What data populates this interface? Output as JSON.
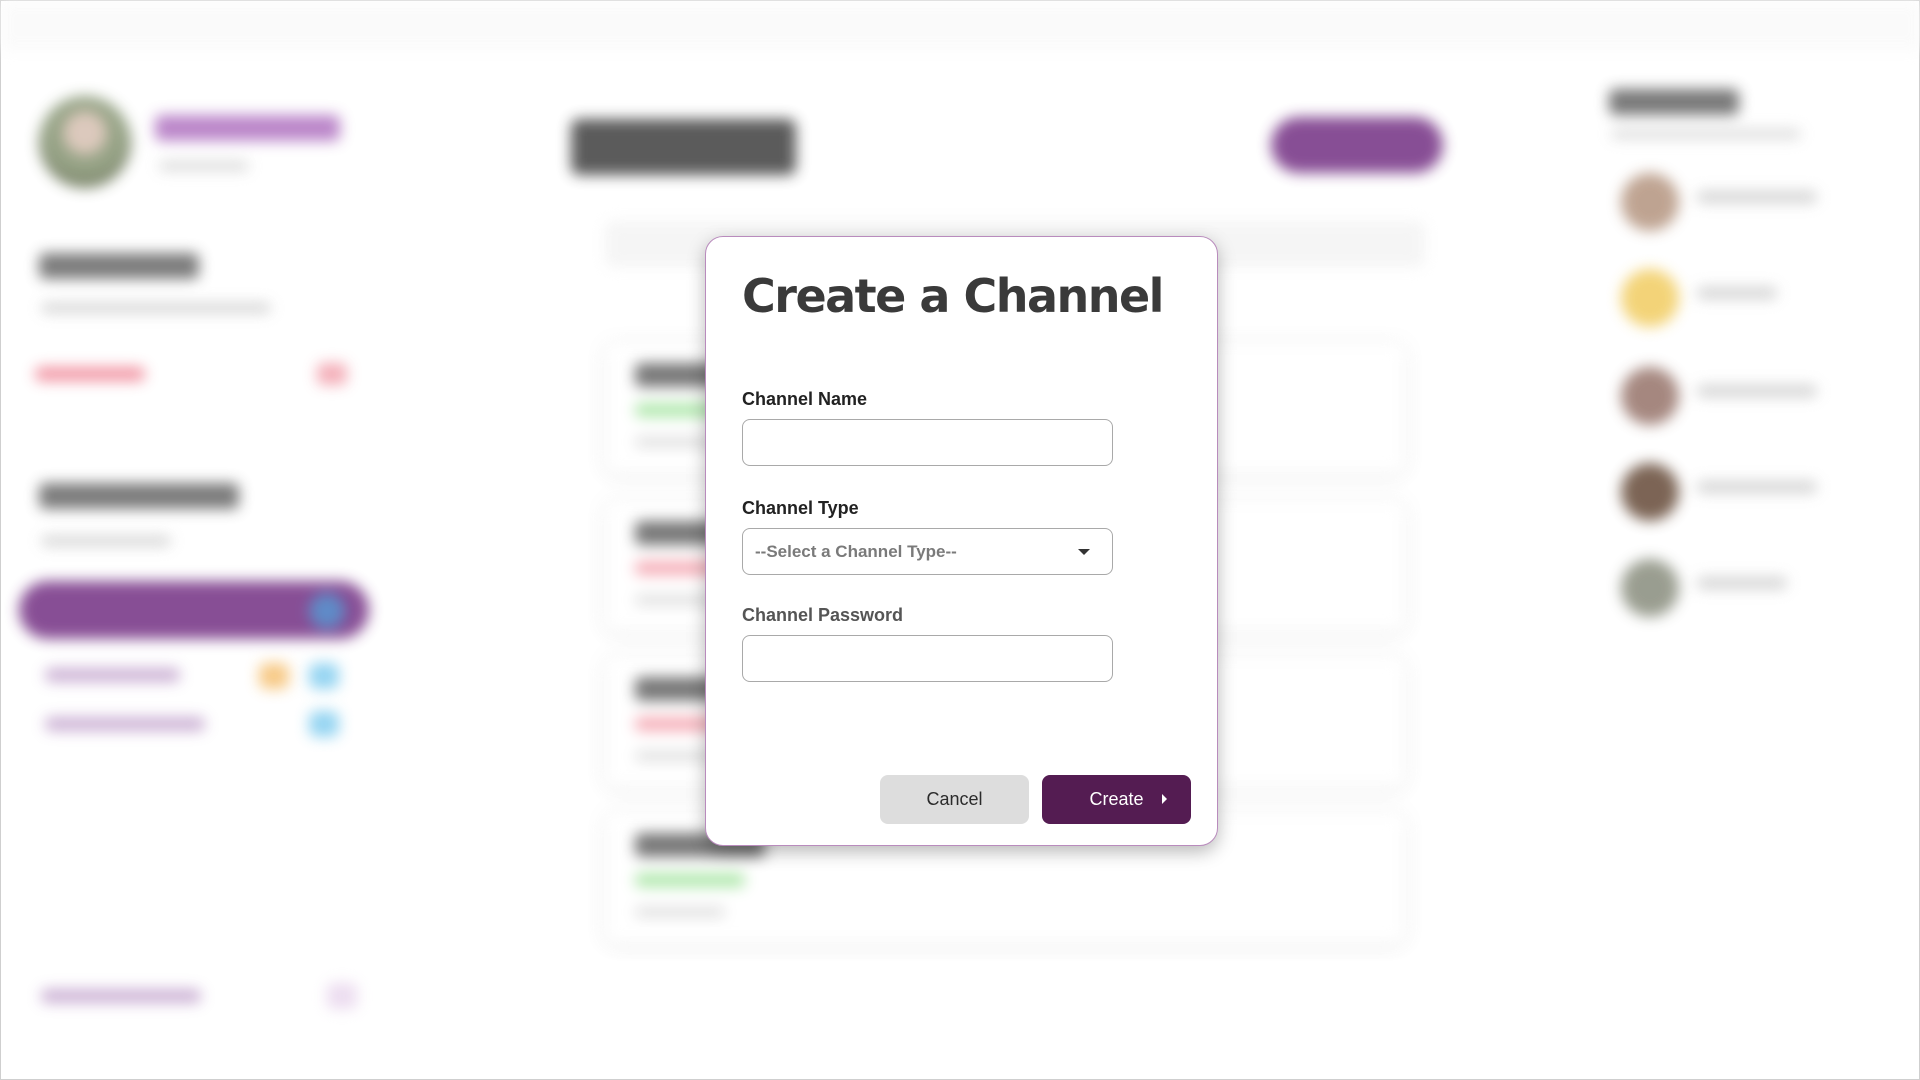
{
  "modal": {
    "title": "Create a Channel",
    "channel_name": {
      "label": "Channel Name",
      "value": "",
      "placeholder": ""
    },
    "channel_type": {
      "label": "Channel Type",
      "selected": "--Select a Channel Type--",
      "icon": "chevron-down-icon"
    },
    "channel_password": {
      "label": "Channel Password",
      "value": "",
      "placeholder": ""
    },
    "cancel_label": "Cancel",
    "create_label": "Create",
    "create_icon": "arrow-right-icon"
  },
  "colors": {
    "accent": "#541c52",
    "modal_border": "#b98bbd",
    "cancel_bg": "#dddddd",
    "title_text": "#3a3a3a"
  }
}
